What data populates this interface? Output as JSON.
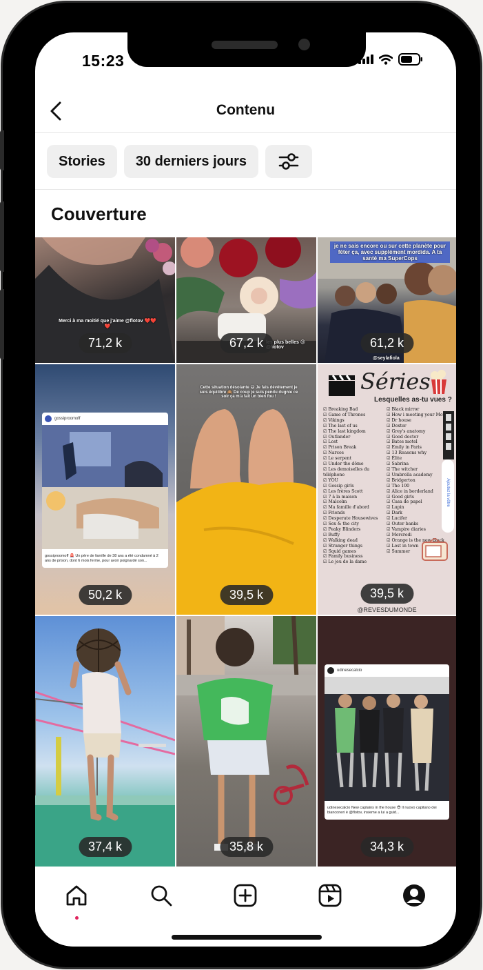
{
  "status_bar": {
    "time": "15:23"
  },
  "header": {
    "title": "Contenu"
  },
  "filters": {
    "type_label": "Stories",
    "period_label": "30 derniers jours"
  },
  "section": {
    "title": "Couverture"
  },
  "stories": [
    {
      "reach": "71,2 k",
      "caption": "Merci à ma moitié que j'aime @flotov ❤️❤️❤️"
    },
    {
      "reach": "67,2 k",
      "caption": "les plus belles 😍 @flotov"
    },
    {
      "reach": "61,2 k",
      "caption": "je ne sais encore ou sur cette planète pour fêter ça, avec supplément mordida. A ta santé ma SuperCops",
      "handle": "@seylafiola"
    },
    {
      "reach": "50,2 k",
      "account": "gossiproomoff",
      "post_text": "gossiproomoff 🚨 Un père de famille de 38 ans a été condamné à 2 ans de prison, dont 6 mois ferme, pour avoir poignardé son..."
    },
    {
      "reach": "39,5 k",
      "caption": "Cette situation désolante 😅 Je fais dévêtement je suis équilibre 🙈 De coup je suis pendu dugnie ce soir ça m'a fait un bien fou !"
    },
    {
      "reach": "39,5 k",
      "title": "Séries",
      "subtitle": "Lesquelles as-tu vues ?",
      "footer": "@REVESDUMONDE",
      "sticker": "Ajoutez la vôtre",
      "col1": [
        "Breaking Bad",
        "Game of Thrones",
        "Vikings",
        "The last of us",
        "The last kingdom",
        "Outlander",
        "Lost",
        "Prison Break",
        "Narcos",
        "Le serpent",
        "Under the dôme",
        "Les demoiselles du téléphone",
        "YOU",
        "Gossip girls",
        "Les frères Scott",
        "7 à la maison",
        "Malcolm",
        "Ma famille d'abord",
        "Friends",
        "Desperate Housewives",
        "Sex & the city",
        "Peaky Blinders",
        "Buffy",
        "Walking dead",
        "Stranger things",
        "Squid games",
        "Family business",
        "Le jeu de la dame"
      ],
      "col2": [
        "Black mirror",
        "How i meeting your Mother",
        "Dr house",
        "Dexter",
        "Grey's anatomy",
        "Good doctor",
        "Bates motel",
        "Emily in Paris",
        "13 Reasons why",
        "Élite",
        "Sabrina",
        "The witcher",
        "Umbrella academy",
        "Bridgerton",
        "The 100",
        "Alice in borderland",
        "Good girls",
        "Casa de papel",
        "Lupin",
        "Dark",
        "Lucifer",
        "Outer banks",
        "Vampire diaries",
        "Mercredi",
        "Orange is the new black",
        "Lost in town",
        "Summer"
      ]
    },
    {
      "reach": "37,4 k"
    },
    {
      "reach": "35,8 k"
    },
    {
      "reach": "34,3 k",
      "account": "udinesecalcio",
      "post_text": "udinesecalcio New captains in the house 😎 Il nuovo capitano dei bianconeri è @flotov, insieme a lui a guid..."
    }
  ],
  "tabbar": {
    "items": [
      "home-icon",
      "search-icon",
      "create-icon",
      "reels-icon",
      "profile-icon"
    ]
  },
  "colors": {
    "accent_dot": "#e0245e",
    "chip_bg": "#efefef",
    "badge_bg": "#282828"
  }
}
